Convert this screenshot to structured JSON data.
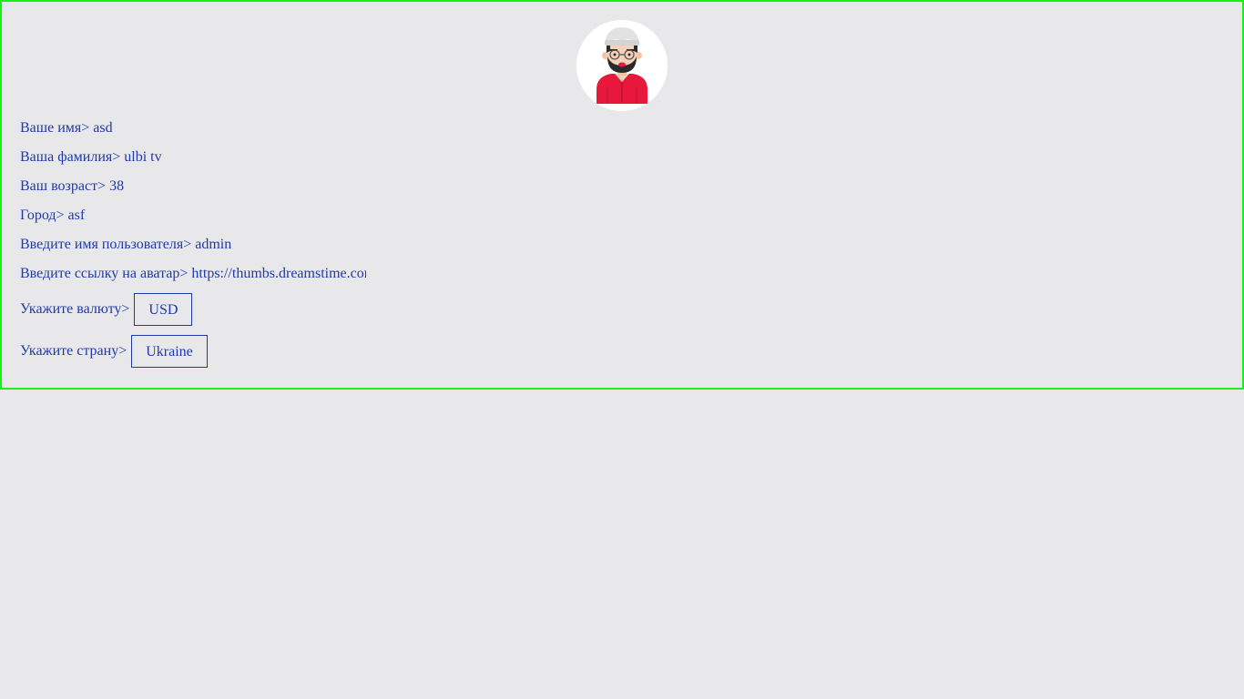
{
  "profile": {
    "avatar_icon": "avatar-man-with-beard-and-glasses-icon",
    "first_name_label": "Ваше имя>",
    "first_name_value": "asd",
    "last_name_label": "Ваша фамилия>",
    "last_name_value": "ulbi tv",
    "age_label": "Ваш возраст>",
    "age_value": "38",
    "city_label": "Город>",
    "city_value": "asf",
    "username_label": "Введите имя пользователя>",
    "username_value": "admin",
    "avatar_url_label": "Введите ссылку на аватар>",
    "avatar_url_value": "https://thumbs.dreamstime.com",
    "currency_label": "Укажите валюту>",
    "currency_value": "USD",
    "country_label": "Укажите страну>",
    "country_value": "Ukraine"
  },
  "colors": {
    "frame_border": "#18f018",
    "text": "#1f3aa6",
    "background": "#e8e8eb"
  }
}
